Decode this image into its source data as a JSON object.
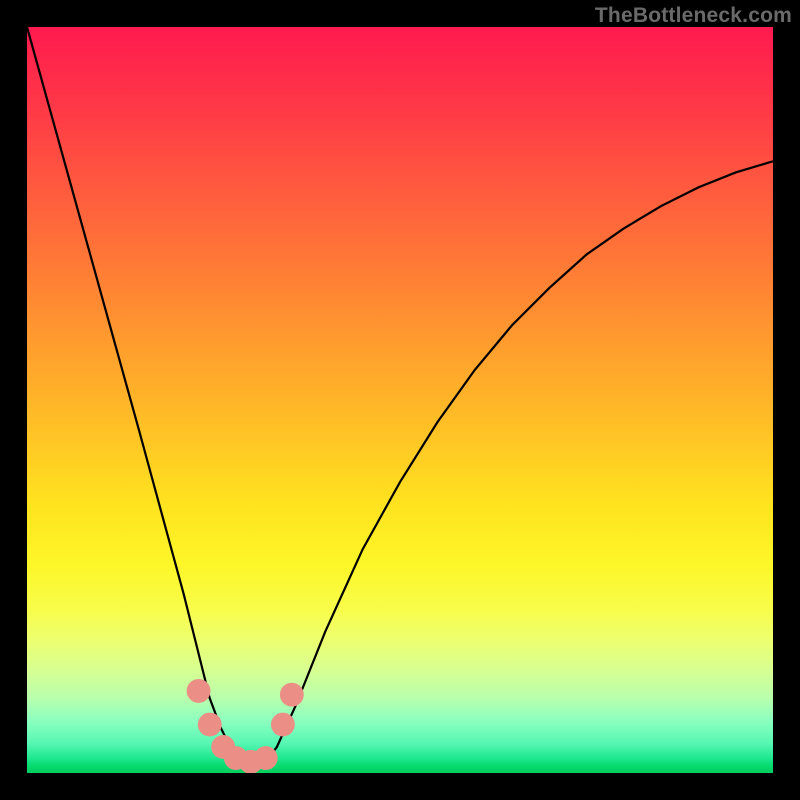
{
  "watermark": {
    "text": "TheBottleneck.com"
  },
  "chart_data": {
    "type": "line",
    "title": "",
    "xlabel": "",
    "ylabel": "",
    "xlim": [
      0,
      100
    ],
    "ylim": [
      0,
      100
    ],
    "axes_visible": false,
    "grid": false,
    "background": "vertical-gradient",
    "background_stops": [
      {
        "pos": 0,
        "color": "#ff1a4f"
      },
      {
        "pos": 20,
        "color": "#ff5540"
      },
      {
        "pos": 42,
        "color": "#ff9b2e"
      },
      {
        "pos": 64,
        "color": "#ffe31f"
      },
      {
        "pos": 82,
        "color": "#eeff6e"
      },
      {
        "pos": 93,
        "color": "#8cffbf"
      },
      {
        "pos": 100,
        "color": "#02cf5e"
      }
    ],
    "series": [
      {
        "name": "bottleneck-curve",
        "color": "#000000",
        "x": [
          0,
          5,
          10,
          15,
          18,
          21,
          23,
          24.5,
          26,
          27.5,
          29,
          30.5,
          32,
          33.5,
          36,
          40,
          45,
          50,
          55,
          60,
          65,
          70,
          75,
          80,
          85,
          90,
          95,
          100
        ],
        "y": [
          100,
          82,
          64,
          46,
          35,
          24,
          16,
          10,
          6,
          3,
          1.5,
          1,
          1.5,
          3.5,
          9,
          19,
          30,
          39,
          47,
          54,
          60,
          65,
          69.5,
          73,
          76,
          78.5,
          80.5,
          82
        ]
      }
    ],
    "markers": [
      {
        "x": 23.0,
        "y": 11.0,
        "color": "#eb8f86",
        "r": 1.6
      },
      {
        "x": 24.5,
        "y": 6.5,
        "color": "#eb8f86",
        "r": 1.6
      },
      {
        "x": 26.3,
        "y": 3.5,
        "color": "#eb8f86",
        "r": 1.6
      },
      {
        "x": 28.0,
        "y": 2.0,
        "color": "#eb8f86",
        "r": 1.6
      },
      {
        "x": 30.0,
        "y": 1.5,
        "color": "#eb8f86",
        "r": 1.6
      },
      {
        "x": 32.0,
        "y": 2.0,
        "color": "#eb8f86",
        "r": 1.6
      },
      {
        "x": 34.3,
        "y": 6.5,
        "color": "#eb8f86",
        "r": 1.6
      },
      {
        "x": 35.5,
        "y": 10.5,
        "color": "#eb8f86",
        "r": 1.6
      }
    ]
  }
}
